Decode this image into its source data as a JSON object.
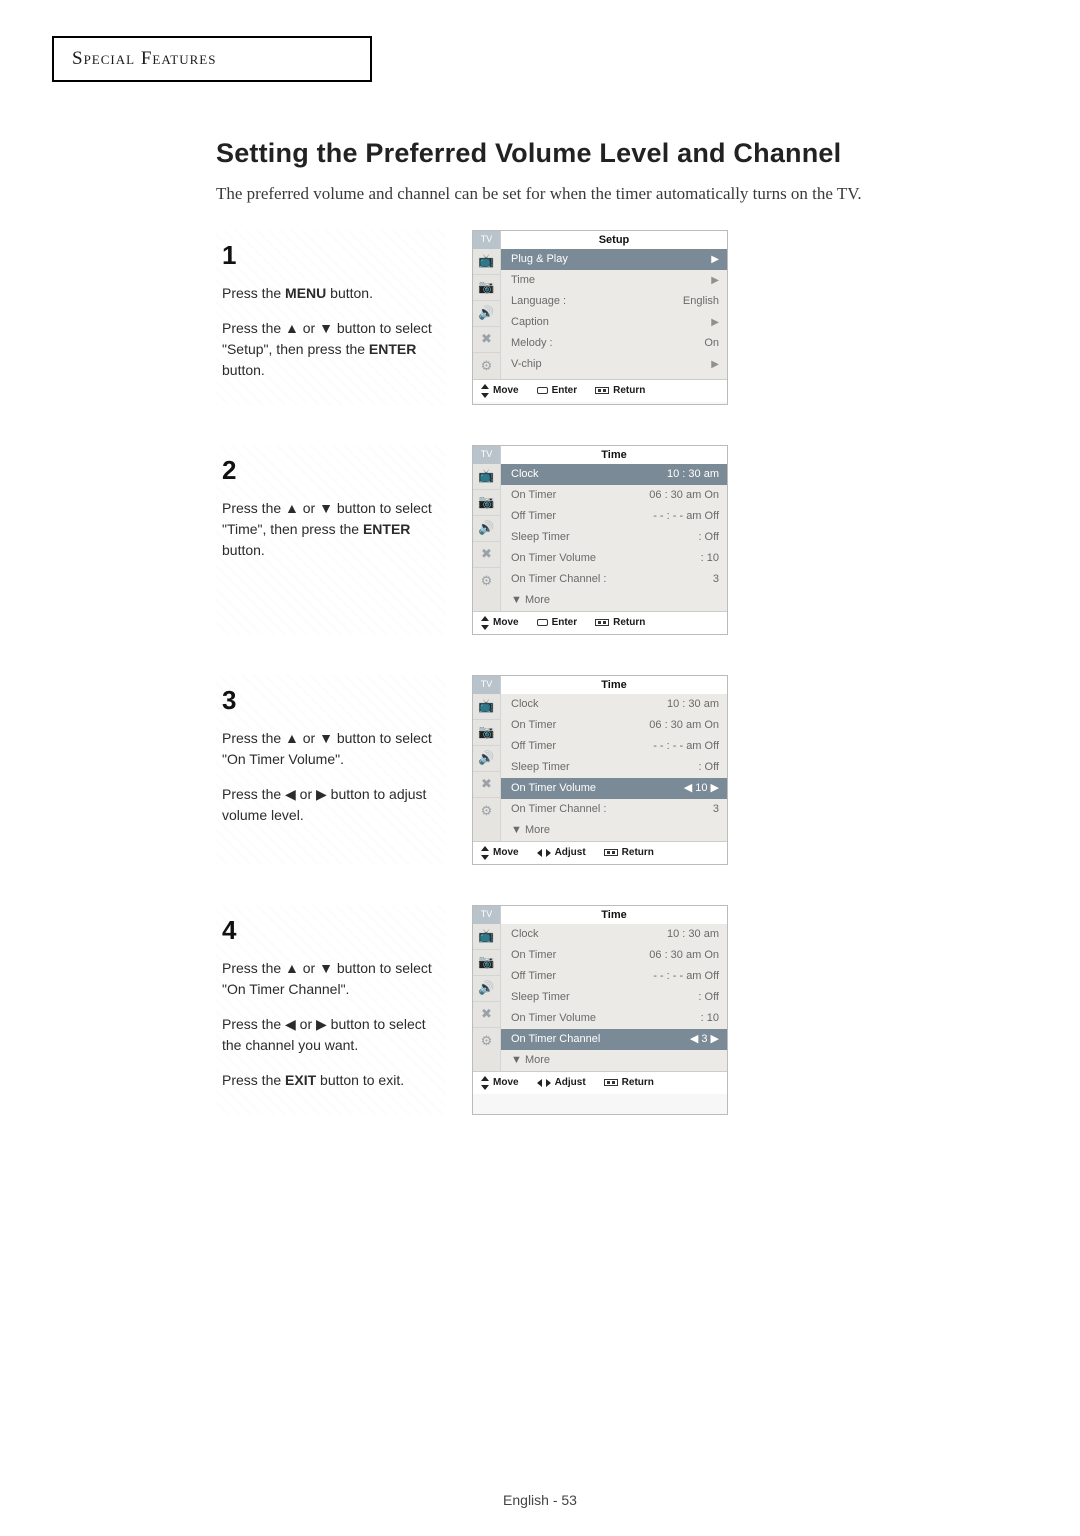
{
  "section_header": "Special Features",
  "heading": "Setting the Preferred Volume Level and Channel",
  "intro": "The preferred volume and channel can be set for when the timer automatically turns on the TV.",
  "footer_hints": {
    "move": "Move",
    "enter": "Enter",
    "adjust": "Adjust",
    "return": "Return"
  },
  "tv_label": "TV",
  "osd_icons": [
    "📺",
    "📷",
    "🔊",
    "✖",
    "⚙"
  ],
  "steps": [
    {
      "num": "1",
      "lines": [
        "Press the <b>MENU</b> button.",
        "Press the ▲ or ▼ button to select \"Setup\", then press the <b>ENTER</b> button."
      ],
      "osd_title": "Setup",
      "footer_style": "enter",
      "rows": [
        {
          "label": "Plug & Play",
          "value": "",
          "arrow": "▶",
          "sel": true
        },
        {
          "label": "Time",
          "value": "",
          "arrow": "▶",
          "sel": false
        },
        {
          "label": "Language :",
          "value": "English",
          "arrow": "",
          "sel": false
        },
        {
          "label": "Caption",
          "value": "",
          "arrow": "▶",
          "sel": false
        },
        {
          "label": "Melody   :",
          "value": "On",
          "arrow": "",
          "sel": false
        },
        {
          "label": "V-chip",
          "value": "",
          "arrow": "▶",
          "sel": false
        }
      ]
    },
    {
      "num": "2",
      "lines": [
        "Press the ▲ or ▼ button to select \"Time\", then press the <b>ENTER</b> button."
      ],
      "osd_title": "Time",
      "footer_style": "enter",
      "rows": [
        {
          "label": "Clock",
          "value": "10 : 30 am",
          "arrow": "",
          "sel": true
        },
        {
          "label": "On Timer",
          "value": "06 : 30 am On",
          "arrow": "",
          "sel": false
        },
        {
          "label": "Off Timer",
          "value": "- - : - - am Off",
          "arrow": "",
          "sel": false
        },
        {
          "label": "Sleep Timer",
          "value": ": Off",
          "arrow": "",
          "sel": false
        },
        {
          "label": "On Timer Volume",
          "value": ": 10",
          "arrow": "",
          "sel": false
        },
        {
          "label": "On Timer Channel :",
          "value": "3",
          "arrow": "",
          "sel": false
        },
        {
          "label": "▼ More",
          "value": "",
          "arrow": "",
          "sel": false
        }
      ]
    },
    {
      "num": "3",
      "lines": [
        "Press the ▲ or ▼ button to select \"On Timer Volume\".",
        "Press the ◀ or ▶ button to adjust volume level."
      ],
      "osd_title": "Time",
      "footer_style": "adjust",
      "rows": [
        {
          "label": "Clock",
          "value": "10 : 30 am",
          "arrow": "",
          "sel": false
        },
        {
          "label": "On Timer",
          "value": "06 : 30 am On",
          "arrow": "",
          "sel": false
        },
        {
          "label": "Off Timer",
          "value": "- - : - - am Off",
          "arrow": "",
          "sel": false
        },
        {
          "label": "Sleep Timer",
          "value": ": Off",
          "arrow": "",
          "sel": false
        },
        {
          "label": "On Timer Volume",
          "value": "◀ 10 ▶",
          "arrow": "",
          "sel": true
        },
        {
          "label": "On Timer Channel :",
          "value": "3",
          "arrow": "",
          "sel": false
        },
        {
          "label": "▼ More",
          "value": "",
          "arrow": "",
          "sel": false
        }
      ]
    },
    {
      "num": "4",
      "lines": [
        "Press the ▲ or ▼ button to select \"On Timer Channel\".",
        "Press the ◀ or ▶ button to select the channel you want.",
        "Press the <b>EXIT</b> button to exit."
      ],
      "osd_title": "Time",
      "footer_style": "adjust",
      "rows": [
        {
          "label": "Clock",
          "value": "10 : 30 am",
          "arrow": "",
          "sel": false
        },
        {
          "label": "On Timer",
          "value": "06 : 30 am On",
          "arrow": "",
          "sel": false
        },
        {
          "label": "Off Timer",
          "value": "- - : - - am Off",
          "arrow": "",
          "sel": false
        },
        {
          "label": "Sleep Timer",
          "value": ": Off",
          "arrow": "",
          "sel": false
        },
        {
          "label": "On Timer Volume",
          "value": ": 10",
          "arrow": "",
          "sel": false
        },
        {
          "label": "On Timer Channel",
          "value": "◀   3 ▶",
          "arrow": "",
          "sel": true
        },
        {
          "label": "▼ More",
          "value": "",
          "arrow": "",
          "sel": false
        }
      ]
    }
  ],
  "page_footer": "English - 53"
}
